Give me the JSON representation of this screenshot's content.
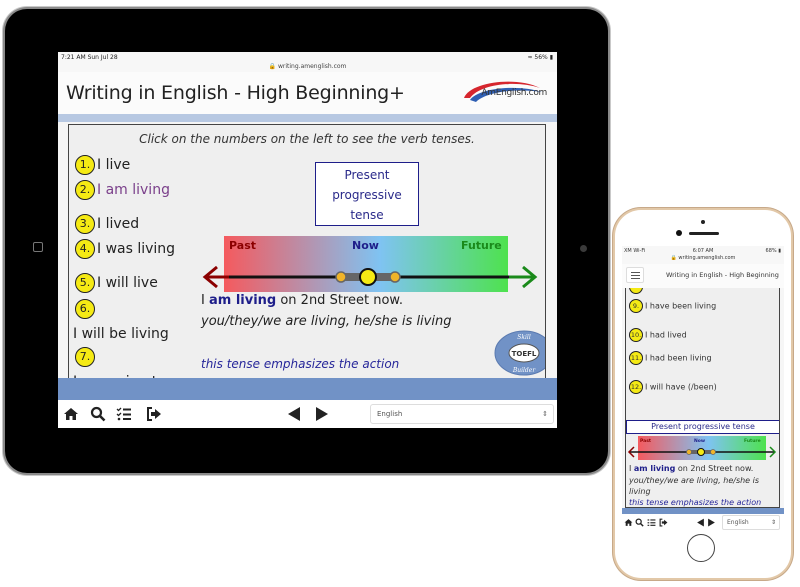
{
  "ipad": {
    "status": {
      "time": "7:21 AM   Sun Jul 28",
      "url": "writing.amenglish.com",
      "battery": "56%"
    },
    "header": {
      "title": "Writing in English - High Beginning+",
      "logo_text": "AmEnglish.com"
    },
    "instruction": "Click on the numbers on the left to see the verb tenses.",
    "tenses": [
      {
        "num": "1.",
        "label": "I live",
        "active": false
      },
      {
        "num": "2.",
        "label": "I am living",
        "active": true
      },
      {
        "num": "3.",
        "label": "I lived",
        "active": false
      },
      {
        "num": "4.",
        "label": "I was living",
        "active": false
      },
      {
        "num": "5.",
        "label": "I will live",
        "active": false
      },
      {
        "num": "6.",
        "label": "",
        "active": false
      },
      {
        "num": "",
        "label": "I will be living",
        "active": false
      },
      {
        "num": "7.",
        "label": "",
        "active": false
      },
      {
        "num": "",
        "label": "I am going to",
        "active": false
      }
    ],
    "tense_name_lines": [
      "Present",
      "progressive",
      "tense"
    ],
    "timeline": {
      "past": "Past",
      "now": "Now",
      "future": "Future"
    },
    "example": {
      "pre": "I ",
      "highlight": "am living",
      "post": " on 2nd Street now."
    },
    "conjugation": "you/they/we are living, he/she is living",
    "emphasis": "this tense emphasizes the action",
    "badge": {
      "top": "Skill",
      "middle": "TOEFL",
      "bottom": "Builder"
    },
    "toolbar": {
      "icons": [
        "home-icon",
        "search-icon",
        "checklist-icon",
        "sign-out-icon"
      ],
      "prev": "previous",
      "next": "next",
      "language": "English"
    }
  },
  "iphone": {
    "status": {
      "carrier": "XM Wi-Fi",
      "time": "6:07 AM",
      "url": "writing.amenglish.com",
      "battery": "68%"
    },
    "header": {
      "title": "Writing in English - High Beginning"
    },
    "tenses": [
      {
        "num": "9.",
        "label": "I have been living"
      },
      {
        "num": "10.",
        "label": "I had lived"
      },
      {
        "num": "11.",
        "label": "I had been living"
      },
      {
        "num": "12.",
        "label": "I will have (/been)"
      }
    ],
    "tense_name": "Present progressive tense",
    "timeline": {
      "past": "Past",
      "now": "Now",
      "future": "Future"
    },
    "example": {
      "pre": "I ",
      "highlight": "am living",
      "post": " on 2nd Street now."
    },
    "conjugation_lines": [
      "you/they/we are living, he/she is",
      "living"
    ],
    "emphasis": "this tense emphasizes the action",
    "toolbar": {
      "language": "English"
    }
  },
  "colors": {
    "accent_blue": "#7192c6",
    "number_yellow": "#f5ea14",
    "past_red": "#8b0000",
    "now_blue": "#1e1e8a",
    "future_green": "#1a8a1a"
  }
}
